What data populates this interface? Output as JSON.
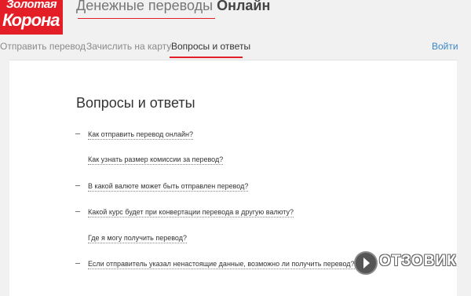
{
  "logo": {
    "line1": "Золотая",
    "line2": "Корона"
  },
  "header": {
    "title_regular": "Денежные переводы",
    "title_bold": "Онлайн"
  },
  "nav": {
    "tabs": [
      {
        "label": "Отправить перевод"
      },
      {
        "label": "Зачислить на карту"
      },
      {
        "label": "Вопросы и ответы",
        "active": true
      }
    ],
    "login_label": "Войти"
  },
  "faq": {
    "title": "Вопросы и ответы",
    "items": [
      {
        "question": "Как отправить перевод онлайн?",
        "expanded_dash": true
      },
      {
        "question": "Как узнать размер комиссии за перевод?",
        "expanded_dash": false
      },
      {
        "question": "В какой валюте может быть отправлен перевод?",
        "expanded_dash": true
      },
      {
        "question": "Какой курс будет при конвертации перевода в другую валюту?",
        "expanded_dash": true
      },
      {
        "question": "Где я могу получить перевод?",
        "expanded_dash": false
      },
      {
        "question": "Если отправитель указал ненастоящие данные, возможно ли получить перевод?",
        "expanded_dash": true
      }
    ]
  },
  "watermark": {
    "text": "ОТЗОВИК"
  },
  "colors": {
    "brand_red": "#e41e26",
    "link_blue": "#3a86c8",
    "background": "#f1f1f1"
  }
}
